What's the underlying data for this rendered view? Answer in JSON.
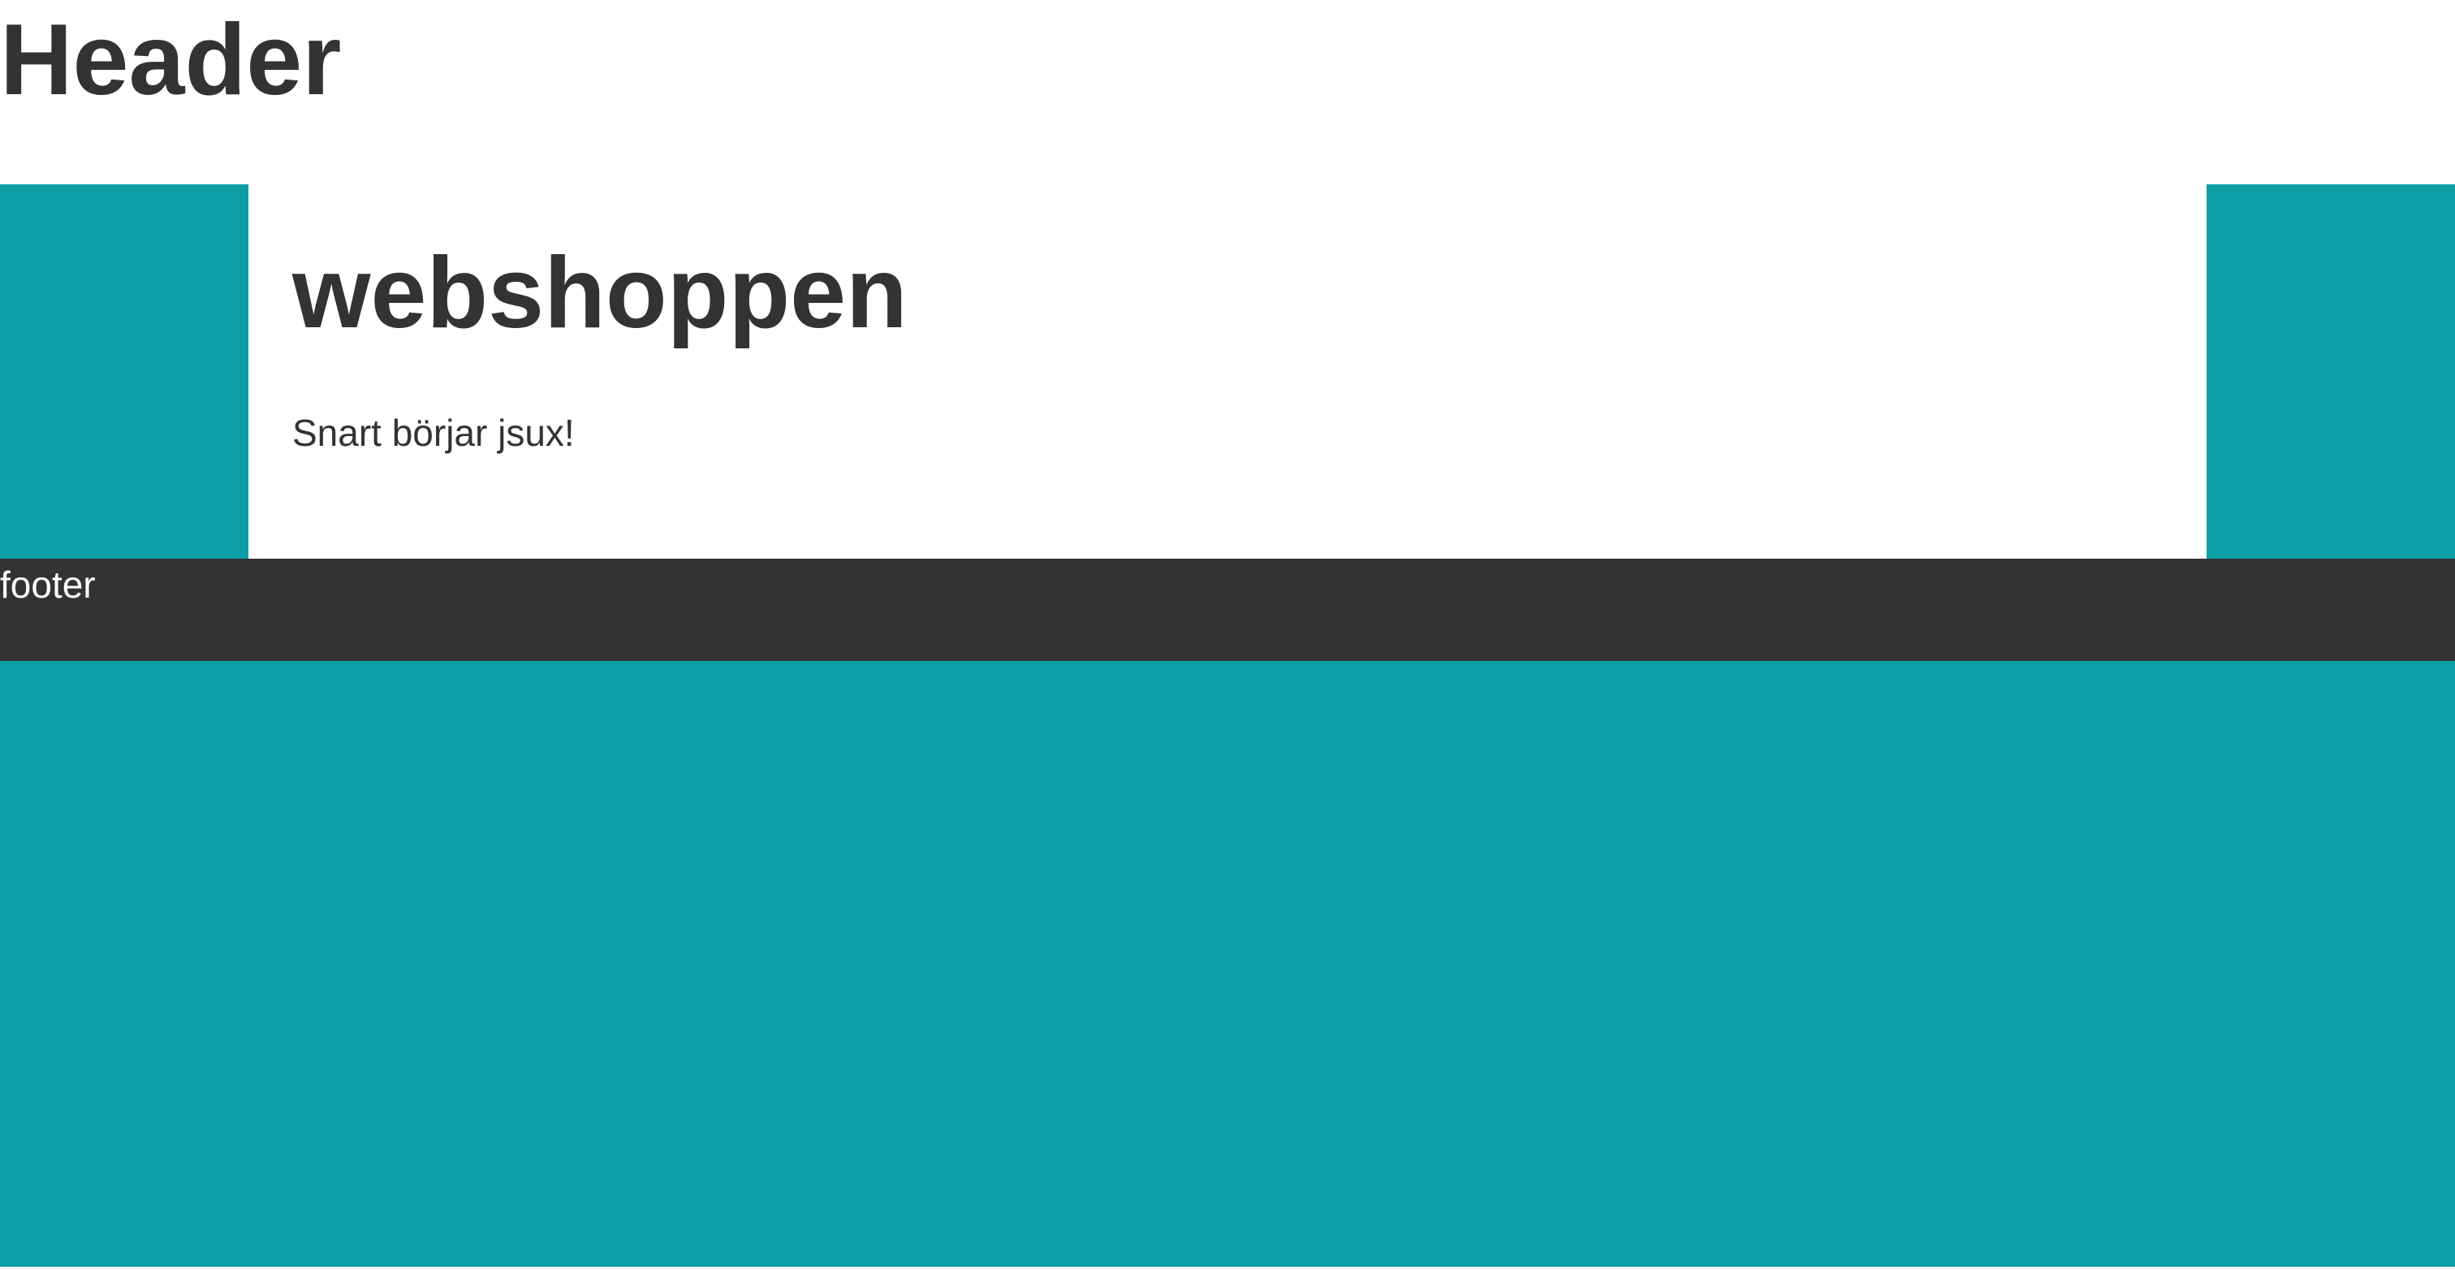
{
  "header": {
    "title": "Header"
  },
  "main": {
    "title": "webshoppen",
    "text": "Snart börjar jsux!"
  },
  "footer": {
    "text": "footer"
  },
  "colors": {
    "background": "#0b9fa5",
    "panel": "#ffffff",
    "text": "#333333",
    "footer_background": "#333333",
    "footer_text": "#ffffff"
  }
}
